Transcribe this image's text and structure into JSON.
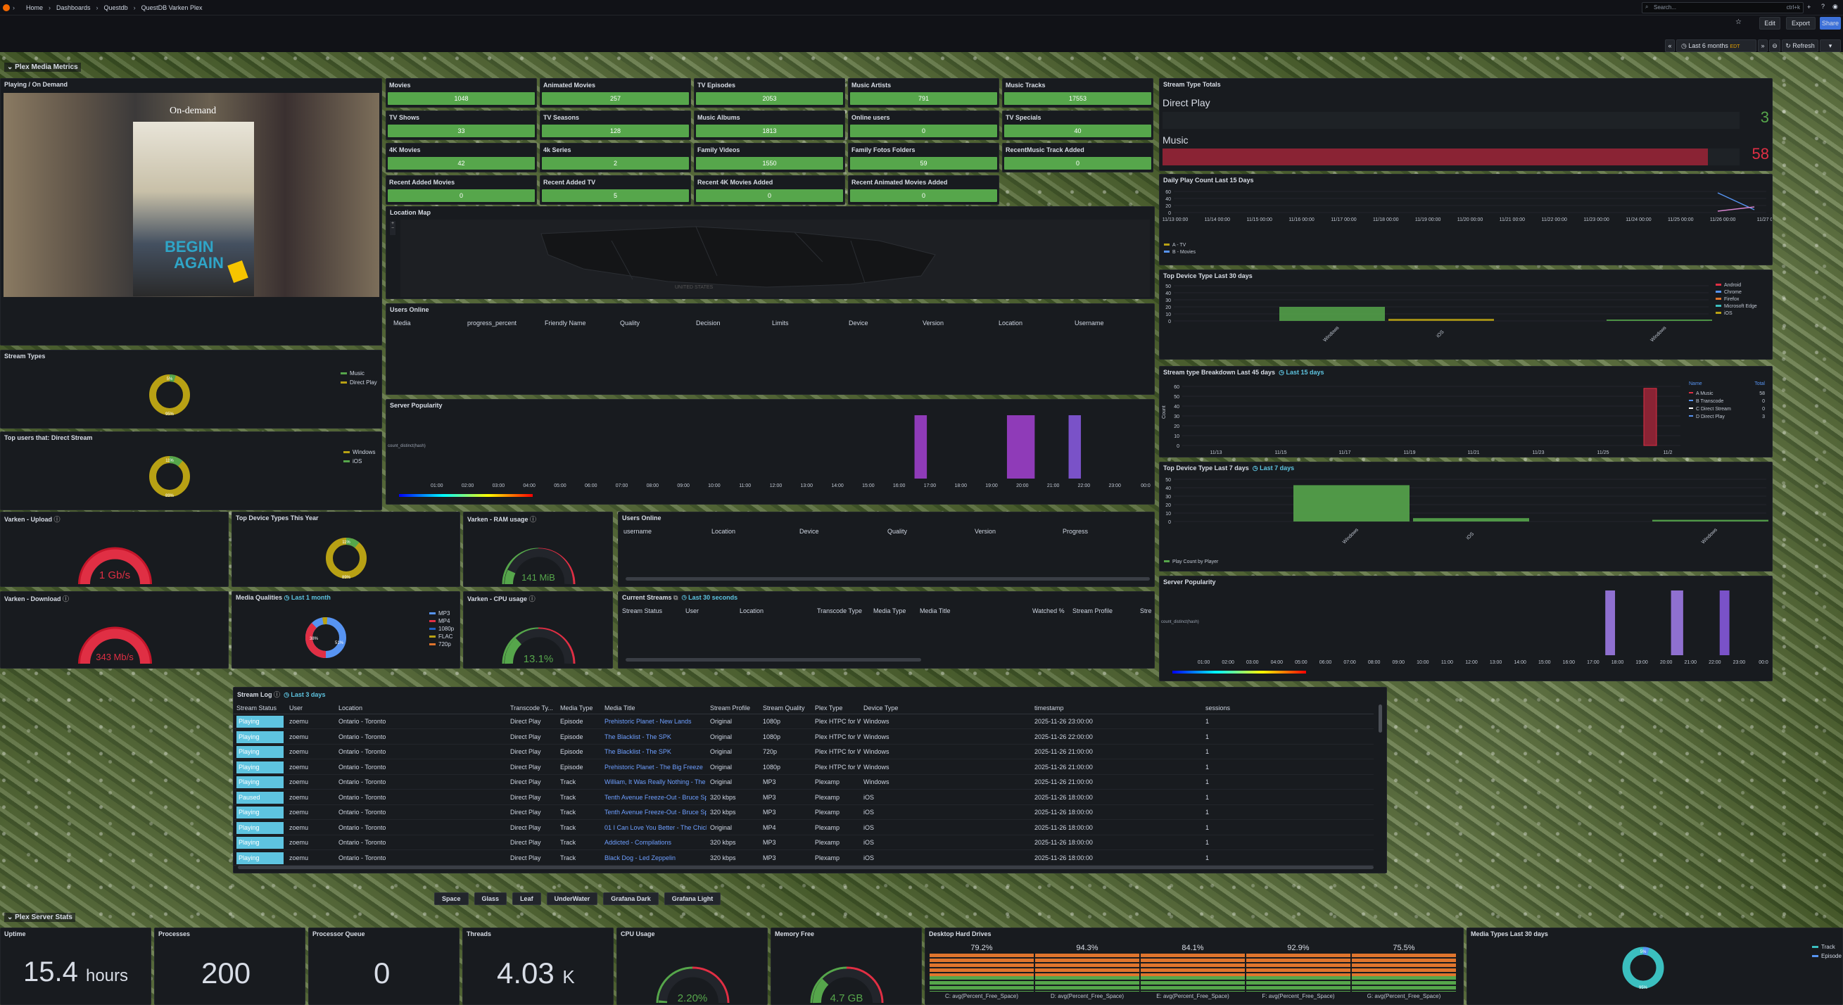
{
  "topbar": {
    "breadcrumbs": [
      "Home",
      "Dashboards",
      "Questdb",
      "QuestDB Varken Plex"
    ],
    "search_placeholder": "Search...",
    "shortcut": "ctrl+k",
    "edit_label": "Edit",
    "export_label": "Export",
    "share_label": "Share"
  },
  "controls": {
    "time_range": "Last 6 months",
    "time_zone": "EDT",
    "refresh_label": "Refresh"
  },
  "section1": {
    "title": "Plex Media Metrics"
  },
  "section2": {
    "title": "Plex Server Stats"
  },
  "playing": {
    "title": "Playing / On Demand",
    "poster_header": "On-demand",
    "poster_title_1": "BEGIN",
    "poster_title_2": "AGAIN"
  },
  "stats": [
    {
      "label": "Movies",
      "value": "1048"
    },
    {
      "label": "Animated Movies",
      "value": "257"
    },
    {
      "label": "TV Episodes",
      "value": "2053"
    },
    {
      "label": "Music Artists",
      "value": "791"
    },
    {
      "label": "Music Tracks",
      "value": "17553"
    },
    {
      "label": "TV Shows",
      "value": "33"
    },
    {
      "label": "TV Seasons",
      "value": "128"
    },
    {
      "label": "Music Albums",
      "value": "1813"
    },
    {
      "label": "Online users",
      "value": "0"
    },
    {
      "label": "TV Specials",
      "value": "40"
    },
    {
      "label": "4K Movies",
      "value": "42"
    },
    {
      "label": "4k Series",
      "value": "2"
    },
    {
      "label": "Family Videos",
      "value": "1550"
    },
    {
      "label": "Family Fotos Folders",
      "value": "59"
    },
    {
      "label": "RecentMusic Track Added",
      "value": "0"
    },
    {
      "label": "Recent Added Movies",
      "value": "0"
    },
    {
      "label": "Recent Added TV",
      "value": "5"
    },
    {
      "label": "Recent 4K Movies Added",
      "value": "0"
    },
    {
      "label": "Recent Animated Movies Added",
      "value": "0"
    }
  ],
  "location_map": {
    "title": "Location Map",
    "country_label": "UNITED STATES"
  },
  "users_online_1": {
    "title": "Users Online",
    "columns": [
      "Media",
      "progress_percent",
      "Friendly Name",
      "Quality",
      "Decision",
      "Limits",
      "Device",
      "Version",
      "Location",
      "Username"
    ]
  },
  "server_popularity_1": {
    "title": "Server Popularity",
    "ylabel": "count_distinct(hash)",
    "hours": [
      "01:00",
      "02:00",
      "03:00",
      "04:00",
      "05:00",
      "06:00",
      "07:00",
      "08:00",
      "09:00",
      "10:00",
      "11:00",
      "12:00",
      "13:00",
      "14:00",
      "15:00",
      "16:00",
      "17:00",
      "18:00",
      "19:00",
      "20:00",
      "21:00",
      "22:00",
      "23:00",
      "00:0"
    ]
  },
  "stream_types": {
    "title": "Stream Types",
    "legend": [
      "Music",
      "Direct Play"
    ],
    "labels": [
      "5%",
      "95%"
    ]
  },
  "top_users_ds": {
    "title": "Top users that: Direct Stream",
    "legend": [
      "Windows",
      "iOS"
    ],
    "labels": [
      "11%",
      "89%"
    ]
  },
  "varken_upload": {
    "title": "Varken - Upload",
    "value": "1 Gb/s"
  },
  "varken_download": {
    "title": "Varken - Download",
    "value": "343 Mb/s"
  },
  "top_device_year": {
    "title": "Top Device Types This Year",
    "labels": [
      "11%",
      "89%"
    ]
  },
  "media_qualities": {
    "title": "Media Qualities",
    "range": "Last 1 month",
    "legend": [
      "MP3",
      "MP4",
      "1080p",
      "FLAC",
      "720p"
    ],
    "labels": [
      "38%",
      "51%"
    ]
  },
  "varken_ram": {
    "title": "Varken - RAM usage",
    "value": "141 MiB"
  },
  "varken_cpu": {
    "title": "Varken - CPU usage",
    "value": "13.1%"
  },
  "users_online_2": {
    "title": "Users Online",
    "columns": [
      "username",
      "Location",
      "Device",
      "Quality",
      "Version",
      "Progress"
    ]
  },
  "current_streams": {
    "title": "Current Streams",
    "range": "Last 30 seconds",
    "columns": [
      "Stream Status",
      "User",
      "Location",
      "Transcode Type",
      "Media Type",
      "Media Title",
      "Watched %",
      "Stream Profile",
      "Stre"
    ]
  },
  "stream_type_totals": {
    "title": "Stream Type Totals",
    "rows": [
      {
        "label": "Direct Play",
        "value": "3"
      },
      {
        "label": "Music",
        "value": "58"
      }
    ]
  },
  "daily_play": {
    "title": "Daily Play Count Last 15 Days",
    "yticks": [
      "60",
      "40",
      "20",
      "0"
    ],
    "dates": [
      "11/13 00:00",
      "11/14 00:00",
      "11/15 00:00",
      "11/16 00:00",
      "11/17 00:00",
      "11/18 00:00",
      "11/19 00:00",
      "11/20 00:00",
      "11/21 00:00",
      "11/22 00:00",
      "11/23 00:00",
      "11/24 00:00",
      "11/25 00:00",
      "11/26 00:00",
      "11/27 0"
    ],
    "legend": [
      "A - TV",
      "B - Movies"
    ]
  },
  "top_device_30": {
    "title": "Top Device Type Last 30 days",
    "yticks": [
      "50",
      "40",
      "30",
      "20",
      "10",
      "0"
    ],
    "categories": [
      "Windows",
      "iOS",
      "Windows"
    ],
    "legend": [
      "Android",
      "Chrome",
      "Firefox",
      "Microsoft Edge",
      "iOS"
    ]
  },
  "breakdown_45": {
    "title": "Stream type Breakdown Last 45 days",
    "range": "Last 15 days",
    "ylabel": "Count",
    "yticks": [
      "60",
      "50",
      "40",
      "30",
      "20",
      "10",
      "0"
    ],
    "dates": [
      "11/13",
      "11/15",
      "11/17",
      "11/19",
      "11/21",
      "11/23",
      "11/25",
      "11/2"
    ],
    "legend_header": [
      "Name",
      "Total"
    ],
    "legend": [
      {
        "name": "A Music",
        "total": "58"
      },
      {
        "name": "B Transcode",
        "total": "0"
      },
      {
        "name": "C Direct Stream",
        "total": "0"
      },
      {
        "name": "D Direct Play",
        "total": "3"
      }
    ]
  },
  "top_device_7": {
    "title": "Top Device Type Last 7 days",
    "range": "Last 7 days",
    "yticks": [
      "50",
      "40",
      "30",
      "20",
      "10",
      "0"
    ],
    "categories": [
      "Windows",
      "iOS",
      "Windows"
    ],
    "legend": "Play Count by Player"
  },
  "server_popularity_2": {
    "title": "Server Popularity",
    "ylabel": "count_distinct(hash)",
    "hours": [
      "01:00",
      "02:00",
      "03:00",
      "04:00",
      "05:00",
      "06:00",
      "07:00",
      "08:00",
      "09:00",
      "10:00",
      "11:00",
      "12:00",
      "13:00",
      "14:00",
      "15:00",
      "16:00",
      "17:00",
      "18:00",
      "19:00",
      "20:00",
      "21:00",
      "22:00",
      "23:00",
      "00:0"
    ]
  },
  "stream_log": {
    "title": "Stream Log",
    "range": "Last 3 days",
    "columns": [
      "Stream Status",
      "User",
      "Location",
      "Transcode Ty...",
      "Media Type",
      "Media Title",
      "Stream Profile",
      "Stream Quality",
      "Plex Type",
      "Device Type",
      "timestamp",
      "sessions"
    ],
    "rows": [
      [
        "Playing",
        "zoemu",
        "Ontario - Toronto",
        "Direct Play",
        "Episode",
        "Prehistoric Planet - New Lands",
        "Original",
        "1080p",
        "Plex HTPC for W",
        "Windows",
        "2025-11-26 23:00:00",
        "1"
      ],
      [
        "Playing",
        "zoemu",
        "Ontario - Toronto",
        "Direct Play",
        "Episode",
        "The Blacklist - The SPK",
        "Original",
        "1080p",
        "Plex HTPC for W",
        "Windows",
        "2025-11-26 22:00:00",
        "1"
      ],
      [
        "Playing",
        "zoemu",
        "Ontario - Toronto",
        "Direct Play",
        "Episode",
        "The Blacklist - The SPK",
        "Original",
        "720p",
        "Plex HTPC for W",
        "Windows",
        "2025-11-26 21:00:00",
        "1"
      ],
      [
        "Playing",
        "zoemu",
        "Ontario - Toronto",
        "Direct Play",
        "Episode",
        "Prehistoric Planet - The Big Freeze",
        "Original",
        "1080p",
        "Plex HTPC for W",
        "Windows",
        "2025-11-26 21:00:00",
        "1"
      ],
      [
        "Playing",
        "zoemu",
        "Ontario - Toronto",
        "Direct Play",
        "Track",
        "William, It Was Really Nothing - The",
        "Original",
        "MP3",
        "Plexamp",
        "Windows",
        "2025-11-26 21:00:00",
        "1"
      ],
      [
        "Paused",
        "zoemu",
        "Ontario - Toronto",
        "Direct Play",
        "Track",
        "Tenth Avenue Freeze-Out - Bruce Sp",
        "320 kbps",
        "MP3",
        "Plexamp",
        "iOS",
        "2025-11-26 18:00:00",
        "1"
      ],
      [
        "Playing",
        "zoemu",
        "Ontario - Toronto",
        "Direct Play",
        "Track",
        "Tenth Avenue Freeze-Out - Bruce Sp",
        "320 kbps",
        "MP3",
        "Plexamp",
        "iOS",
        "2025-11-26 18:00:00",
        "1"
      ],
      [
        "Playing",
        "zoemu",
        "Ontario - Toronto",
        "Direct Play",
        "Track",
        "01 I Can Love You Better - The Chick",
        "Original",
        "MP4",
        "Plexamp",
        "iOS",
        "2025-11-26 18:00:00",
        "1"
      ],
      [
        "Playing",
        "zoemu",
        "Ontario - Toronto",
        "Direct Play",
        "Track",
        "Addicted - Compilations",
        "320 kbps",
        "MP3",
        "Plexamp",
        "iOS",
        "2025-11-26 18:00:00",
        "1"
      ],
      [
        "Playing",
        "zoemu",
        "Ontario - Toronto",
        "Direct Play",
        "Track",
        "Black Dog - Led Zeppelin",
        "320 kbps",
        "MP3",
        "Plexamp",
        "iOS",
        "2025-11-26 18:00:00",
        "1"
      ]
    ]
  },
  "themes": [
    "Space",
    "Glass",
    "Leaf",
    "UnderWater",
    "Grafana Dark",
    "Grafana Light"
  ],
  "server_stats": {
    "uptime": {
      "title": "Uptime",
      "value": "15.4",
      "unit": "hours"
    },
    "processes": {
      "title": "Processes",
      "value": "200"
    },
    "queue": {
      "title": "Processor Queue",
      "value": "0"
    },
    "threads": {
      "title": "Threads",
      "value": "4.03",
      "unit": "K"
    },
    "cpu": {
      "title": "CPU Usage",
      "value": "2.20%"
    },
    "memory": {
      "title": "Memory Free",
      "value": "4.7 GB"
    },
    "drives": {
      "title": "Desktop Hard Drives",
      "items": [
        {
          "pct": "79.2%",
          "label": "C: avg(Percent_Free_Space)"
        },
        {
          "pct": "94.3%",
          "label": "D: avg(Percent_Free_Space)"
        },
        {
          "pct": "84.1%",
          "label": "E: avg(Percent_Free_Space)"
        },
        {
          "pct": "92.9%",
          "label": "F: avg(Percent_Free_Space)"
        },
        {
          "pct": "75.5%",
          "label": "G: avg(Percent_Free_Space)"
        }
      ]
    },
    "media_types": {
      "title": "Media Types Last 30 days",
      "legend": [
        "Track",
        "Episode"
      ],
      "labels": [
        "5%",
        "95%"
      ]
    }
  },
  "colors": {
    "green": "#56a64b",
    "red": "#e02f44",
    "yellow": "#b8a114",
    "blue": "#5794f2",
    "cyan": "#5ec4e0",
    "purple": "#8f3bb8"
  }
}
